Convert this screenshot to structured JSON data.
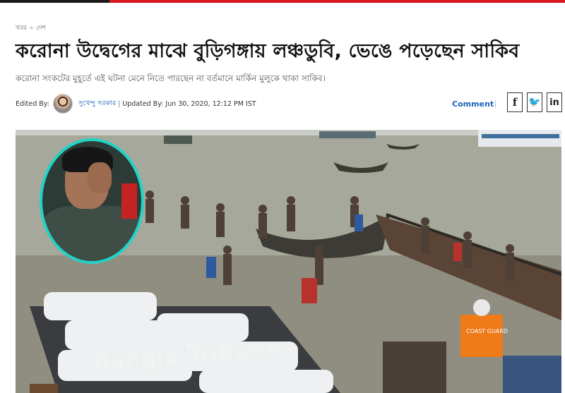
{
  "breadcrumb": {
    "items": [
      "খবর",
      "দেশ"
    ],
    "separator": "»"
  },
  "headline": "করোনা উদ্বেগের মাঝে বুড়িগঙ্গায় লঞ্চডুবি, ভেঙে পড়েছেন সাকিব",
  "subtitle": "করোনা সংকটের মুহূর্তে এই ঘটনা মেনে নিতে পারছেন না বর্তমানে মার্কিন মুলুকে থাকা সাকিব।",
  "byline": {
    "edited_label": "Edited By:",
    "editor": "সুখেন্দু সরকার",
    "separator": "|",
    "updated": "Updated By: Jun 30, 2020, 12:12 PM IST"
  },
  "actions": {
    "comment_label": "Comment",
    "divider": "|",
    "social": [
      {
        "glyph": "f",
        "icon": "facebook-icon"
      },
      {
        "glyph": "🐦",
        "icon": "twitter-icon"
      },
      {
        "glyph": "in",
        "icon": "linkedin-icon"
      }
    ]
  },
  "photo": {
    "watermark": "Bangla Tribune",
    "vest_label": "COAST GUARD"
  },
  "colors": {
    "brand_red": "#d71920",
    "link_blue": "#1a64b8",
    "inset_ring": "#21d3c7"
  }
}
